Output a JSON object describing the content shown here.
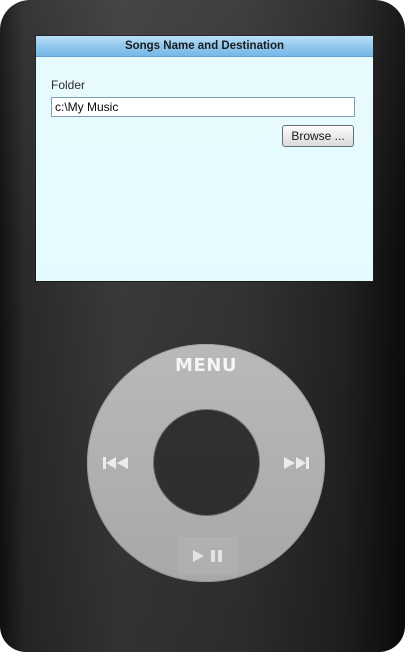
{
  "window": {
    "title": "Songs Name and Destination"
  },
  "form": {
    "folder_label": "Folder",
    "folder_value": "c:\\My Music",
    "browse_label": "Browse ..."
  },
  "wheel": {
    "menu_label": "MENU",
    "icons": [
      "previous-icon",
      "next-icon",
      "play-pause-icon"
    ]
  },
  "colors": {
    "device_body": "#333333",
    "screen_background": "#e6fbff",
    "titlebar_accent": "#8fc8ef",
    "wheel": "#bfbfbf",
    "wheel_center": "#333333"
  }
}
